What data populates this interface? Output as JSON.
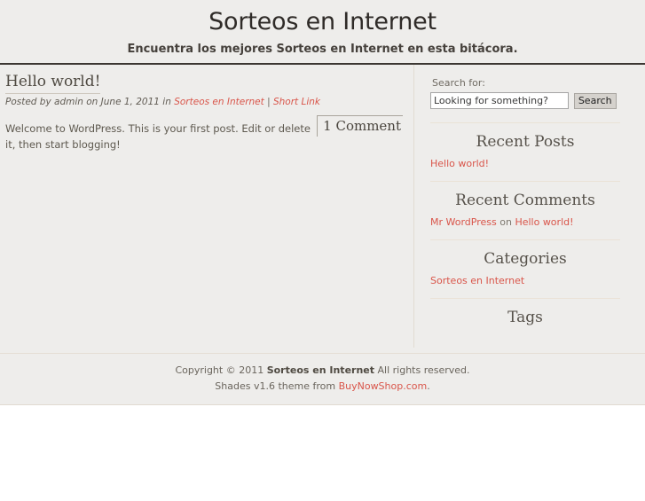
{
  "header": {
    "blog_title": "Sorteos en Internet",
    "blog_description": "Encuentra los mejores Sorteos en Internet en esta bitácora."
  },
  "post": {
    "title": "Hello world!",
    "meta_prefix": "Posted by admin on June 1, 2011 in ",
    "category_link": "Sorteos en Internet",
    "meta_separator": " | ",
    "shortlink_label": "Short Link",
    "body": "Welcome to WordPress. This is your first post. Edit or delete it, then start blogging!",
    "comment_count": "1 Comment"
  },
  "sidebar": {
    "search": {
      "label": "Search for:",
      "value": "Looking for something?",
      "placeholder": "Looking for something?",
      "button_label": "Search"
    },
    "recent_posts": {
      "title": "Recent Posts",
      "items": [
        "Hello world!"
      ]
    },
    "recent_comments": {
      "title": "Recent Comments",
      "items": [
        {
          "author": "Mr WordPress",
          "on": " on ",
          "post": "Hello world!"
        }
      ]
    },
    "categories": {
      "title": "Categories",
      "items": [
        "Sorteos en Internet"
      ]
    },
    "tags": {
      "title": "Tags",
      "items": []
    }
  },
  "footer": {
    "copyright_prefix": "Copyright © 2011 ",
    "site_name": "Sorteos en Internet",
    "copyright_suffix": " All rights reserved.",
    "theme_prefix": "Shades v1.6 theme from ",
    "theme_link": "BuyNowShop.com",
    "theme_suffix": "."
  },
  "colors": {
    "link": "#d9554a",
    "page_bg": "#eeedeb",
    "header_rule": "#3c3733",
    "text": "#5e594f"
  }
}
